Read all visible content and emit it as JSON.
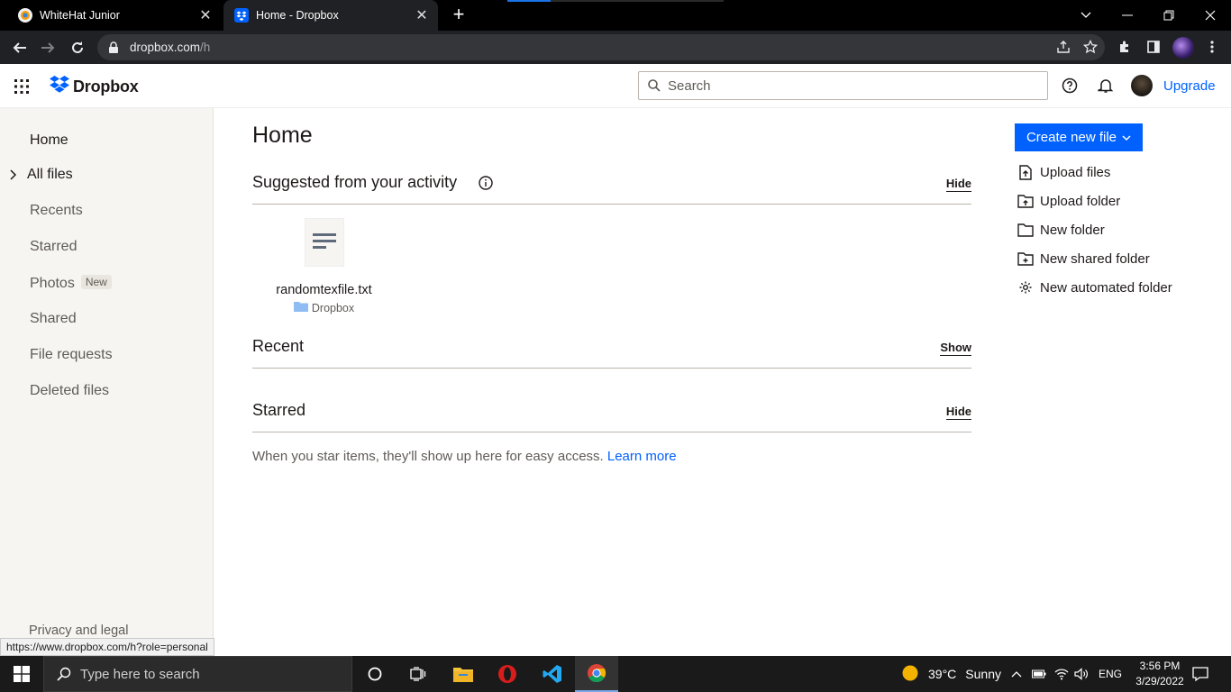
{
  "browser": {
    "tabs": [
      {
        "title": "WhiteHat Junior"
      },
      {
        "title": "Home - Dropbox"
      }
    ],
    "url_host": "dropbox.com",
    "url_path": "/h",
    "status_url": "https://www.dropbox.com/h?role=personal"
  },
  "header": {
    "logo_text": "Dropbox",
    "search_placeholder": "Search",
    "upgrade_label": "Upgrade"
  },
  "sidebar": {
    "items": [
      {
        "label": "Home"
      },
      {
        "label": "All files"
      },
      {
        "label": "Recents"
      },
      {
        "label": "Starred"
      },
      {
        "label": "Photos",
        "badge": "New"
      },
      {
        "label": "Shared"
      },
      {
        "label": "File requests"
      },
      {
        "label": "Deleted files"
      }
    ],
    "footer_link": "Privacy and legal"
  },
  "main": {
    "title": "Home",
    "suggested": {
      "title": "Suggested from your activity",
      "action": "Hide"
    },
    "suggested_file": {
      "name": "randomtexfile.txt",
      "location": "Dropbox"
    },
    "recent": {
      "title": "Recent",
      "action": "Show"
    },
    "starred": {
      "title": "Starred",
      "action": "Hide"
    },
    "starred_empty": "When you star items, they'll show up here for easy access.",
    "learn_more": "Learn more"
  },
  "actions": {
    "create_new_file": "Create new file",
    "items": [
      {
        "label": "Upload files",
        "icon": "upload-file-icon"
      },
      {
        "label": "Upload folder",
        "icon": "upload-folder-icon"
      },
      {
        "label": "New folder",
        "icon": "folder-icon"
      },
      {
        "label": "New shared folder",
        "icon": "shared-folder-icon"
      },
      {
        "label": "New automated folder",
        "icon": "gear-icon"
      }
    ]
  },
  "taskbar": {
    "search_placeholder": "Type here to search",
    "weather_temp": "39°C",
    "weather_text": "Sunny",
    "language": "ENG",
    "time": "3:56 PM",
    "date": "3/29/2022"
  },
  "colors": {
    "accent": "#0061fe",
    "sidebar_bg": "#f7f5f2",
    "text": "#1e1919"
  }
}
